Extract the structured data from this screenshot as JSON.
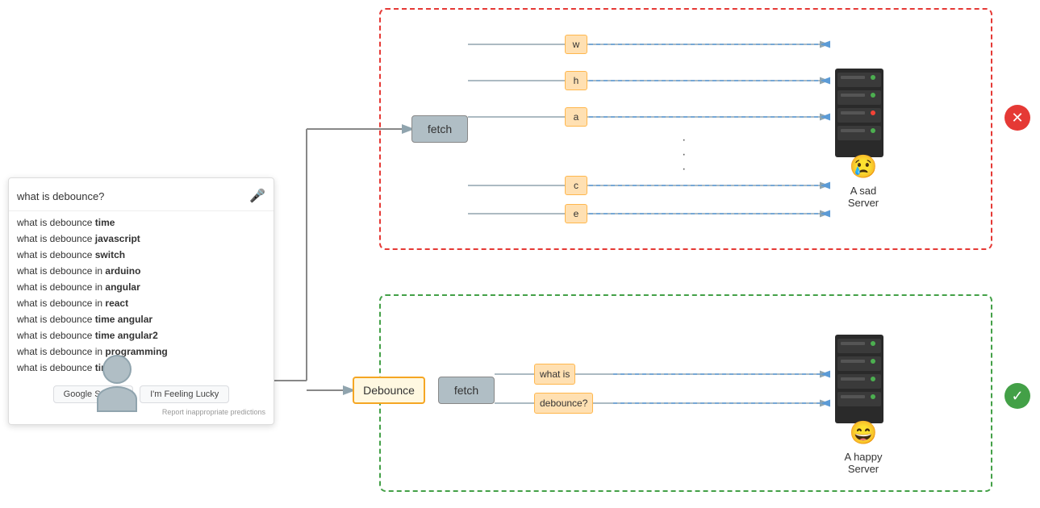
{
  "search": {
    "query": "what is debounce?",
    "mic_label": "🎤",
    "suggestions": [
      {
        "text": "what is debounce ",
        "bold": "time"
      },
      {
        "text": "what is debounce ",
        "bold": "javascript"
      },
      {
        "text": "what is debounce ",
        "bold": "switch"
      },
      {
        "text": "what is debounce in ",
        "bold": "arduino"
      },
      {
        "text": "what is debounce in ",
        "bold": "angular"
      },
      {
        "text": "what is debounce in ",
        "bold": "react"
      },
      {
        "text": "what is debounce ",
        "bold": "time angular"
      },
      {
        "text": "what is debounce ",
        "bold": "time angular2"
      },
      {
        "text": "what is debounce in ",
        "bold": "programming"
      },
      {
        "text": "what is debounce ",
        "bold": "timer"
      }
    ],
    "button1": "Google Search",
    "button2": "I'm Feeling Lucky",
    "report": "Report inappropriate predictions"
  },
  "top_scenario": {
    "fetch_label": "fetch",
    "letters": [
      "w",
      "h",
      "a",
      "c",
      "e"
    ],
    "server_emoji": "😢",
    "server_label": "A sad\nServer",
    "result": "x"
  },
  "bottom_scenario": {
    "debounce_label": "Debounce",
    "fetch_label": "fetch",
    "words": [
      "what is",
      "debounce?"
    ],
    "server_emoji": "😄",
    "server_label": "A happy\nServer",
    "result": "check"
  },
  "colors": {
    "red_dashed": "#e53935",
    "green_dashed": "#43a047",
    "fetch_bg": "#b0bec5",
    "letter_bg": "#ffe0b2",
    "letter_border": "#ffb74d",
    "debounce_border": "#f5a623",
    "arrow_forward": "#90a4ae",
    "arrow_back": "#5c9bd6"
  }
}
